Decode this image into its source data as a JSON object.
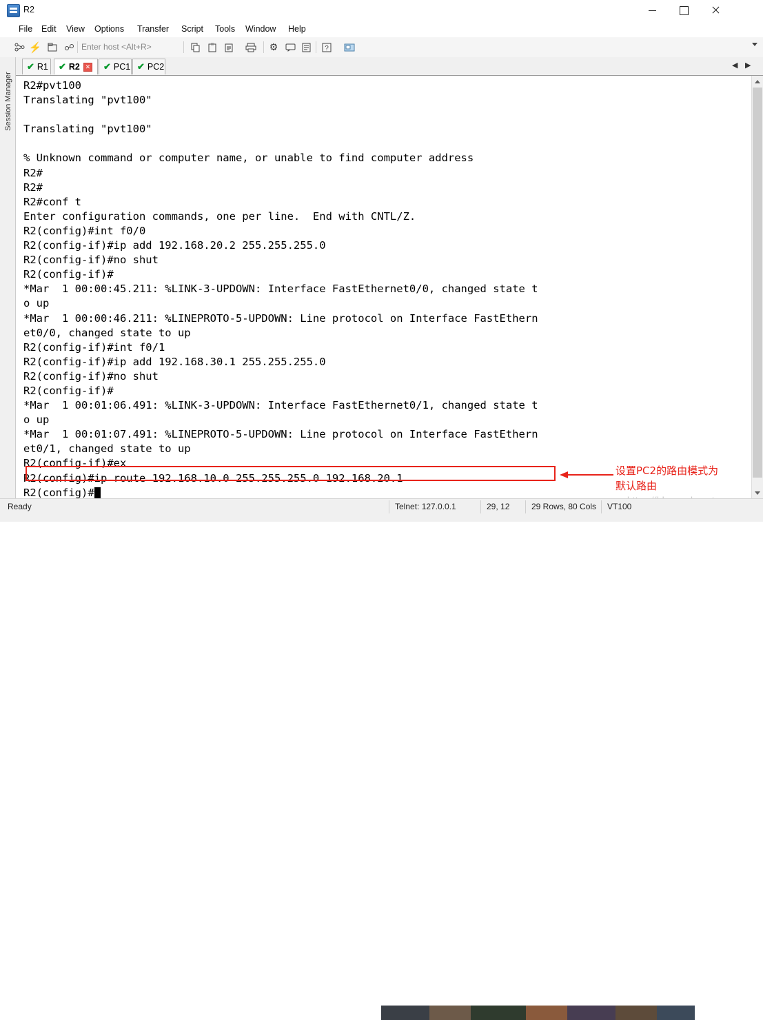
{
  "window": {
    "title": "R2",
    "icon": "terminal-app-icon",
    "minimize": "minimize-icon",
    "maximize": "maximize-icon",
    "close": "close-icon"
  },
  "menu": {
    "items": [
      "File",
      "Edit",
      "View",
      "Options",
      "Transfer",
      "Script",
      "Tools",
      "Window",
      "Help"
    ]
  },
  "toolbar": {
    "host_placeholder": "Enter host <Alt+R>",
    "icons": [
      "connect-icon",
      "quick-connect-icon",
      "connect-in-tab-icon",
      "reconnect-icon",
      "copy-icon",
      "paste-icon",
      "clipboard-icon",
      "print-icon",
      "session-options-icon",
      "chat-window-icon",
      "log-session-icon",
      "help-icon",
      "screenshot-icon"
    ]
  },
  "tabs": {
    "items": [
      {
        "label": "R1",
        "active": false,
        "closable": false
      },
      {
        "label": "R2",
        "active": true,
        "closable": true
      },
      {
        "label": "PC1",
        "active": false,
        "closable": false
      },
      {
        "label": "PC2",
        "active": false,
        "closable": false
      }
    ],
    "nav_prev": "◀",
    "nav_next": "▶"
  },
  "sidebar": {
    "label": "Session Manager"
  },
  "terminal": {
    "lines": [
      "R2#pvt100",
      "Translating \"pvt100\"",
      "",
      "Translating \"pvt100\"",
      "",
      "% Unknown command or computer name, or unable to find computer address",
      "R2#",
      "R2#",
      "R2#conf t",
      "Enter configuration commands, one per line.  End with CNTL/Z.",
      "R2(config)#int f0/0",
      "R2(config-if)#ip add 192.168.20.2 255.255.255.0",
      "R2(config-if)#no shut",
      "R2(config-if)#",
      "*Mar  1 00:00:45.211: %LINK-3-UPDOWN: Interface FastEthernet0/0, changed state t",
      "o up",
      "*Mar  1 00:00:46.211: %LINEPROTO-5-UPDOWN: Line protocol on Interface FastEthern",
      "et0/0, changed state to up",
      "R2(config-if)#int f0/1",
      "R2(config-if)#ip add 192.168.30.1 255.255.255.0",
      "R2(config-if)#no shut",
      "R2(config-if)#",
      "*Mar  1 00:01:06.491: %LINK-3-UPDOWN: Interface FastEthernet0/1, changed state t",
      "o up",
      "*Mar  1 00:01:07.491: %LINEPROTO-5-UPDOWN: Line protocol on Interface FastEthern",
      "et0/1, changed state to up",
      "R2(config-if)#ex",
      "R2(config)#ip route 192.168.10.0 255.255.255.0 192.168.20.1"
    ],
    "prompt": "R2(config)#"
  },
  "annotation": {
    "text_line1": "设置PC2的路由模式为",
    "text_line2": "默认路由",
    "color": "#e8231a"
  },
  "watermarks": {
    "blog": "https://blog.csdn.net",
    "site": "亿速云"
  },
  "statusbar": {
    "ready": "Ready",
    "connection": "Telnet: 127.0.0.1",
    "cursor": "29, 12",
    "size": "29 Rows, 80 Cols",
    "emulation": "VT100"
  }
}
